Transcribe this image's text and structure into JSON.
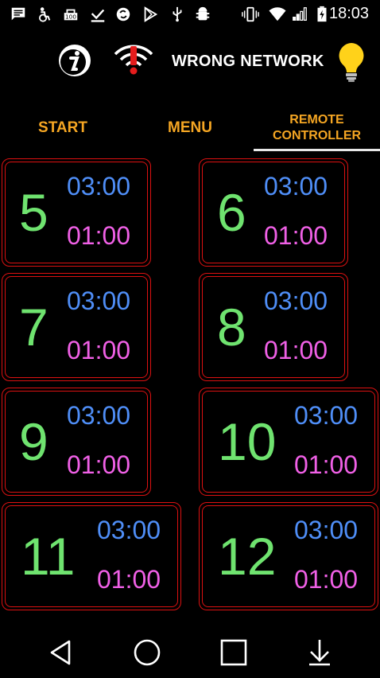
{
  "status_bar": {
    "time": "18:03",
    "icons": [
      "message-icon",
      "accessibility-icon",
      "storage-100-icon",
      "download-done-icon",
      "sync-icon",
      "play-store-icon",
      "usb-icon",
      "android-debug-icon",
      "vibrate-icon",
      "wifi-icon",
      "cell-signal-icon",
      "battery-charging-icon"
    ]
  },
  "header": {
    "info_icon": "info-icon",
    "wifi_warning_icon": "wifi-error-icon",
    "network_status": "WRONG NETWORK",
    "light_icon": "light-bulb-icon"
  },
  "tabs": [
    {
      "label": "START"
    },
    {
      "label": "MENU"
    },
    {
      "label_line1": "REMOTE",
      "label_line2": "CONTROLLER",
      "active": true
    }
  ],
  "tiles": [
    {
      "number": "5",
      "on_time": "03:00",
      "off_time": "01:00"
    },
    {
      "number": "6",
      "on_time": "03:00",
      "off_time": "01:00"
    },
    {
      "number": "7",
      "on_time": "03:00",
      "off_time": "01:00"
    },
    {
      "number": "8",
      "on_time": "03:00",
      "off_time": "01:00"
    },
    {
      "number": "9",
      "on_time": "03:00",
      "off_time": "01:00"
    },
    {
      "number": "10",
      "on_time": "03:00",
      "off_time": "01:00"
    },
    {
      "number": "11",
      "on_time": "03:00",
      "off_time": "01:00"
    },
    {
      "number": "12",
      "on_time": "03:00",
      "off_time": "01:00"
    }
  ],
  "colors": {
    "tab_text": "#f5a623",
    "tile_border": "#dd1111",
    "tile_number": "#6fe36f",
    "on_time": "#4f8ef7",
    "off_time": "#f060e6"
  },
  "nav_bar": {
    "buttons": [
      "back-icon",
      "home-icon",
      "recents-icon",
      "keyboard-hide-icon"
    ]
  }
}
